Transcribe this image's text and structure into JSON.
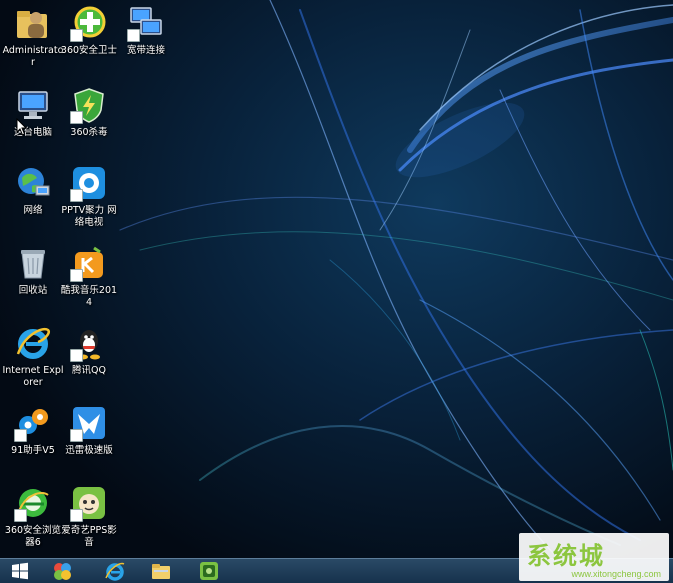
{
  "desktop": {
    "icons": [
      {
        "label": "Administrator",
        "icon": "user-folder-icon"
      },
      {
        "label": "360安全卫士",
        "icon": "360-safeguard-icon"
      },
      {
        "label": "宽带连接",
        "icon": "broadband-connection-icon"
      },
      {
        "label": "这台电脑",
        "icon": "this-pc-icon"
      },
      {
        "label": "360杀毒",
        "icon": "360-antivirus-icon"
      },
      {
        "label": "网络",
        "icon": "network-icon"
      },
      {
        "label": "PPTV聚力 网络电视",
        "icon": "pptv-icon"
      },
      {
        "label": "回收站",
        "icon": "recycle-bin-icon"
      },
      {
        "label": "酷我音乐2014",
        "icon": "kuwo-music-icon"
      },
      {
        "label": "Internet Explorer",
        "icon": "internet-explorer-icon"
      },
      {
        "label": "腾讯QQ",
        "icon": "qq-icon"
      },
      {
        "label": "91助手V5",
        "icon": "91-assistant-icon"
      },
      {
        "label": "迅雷极速版",
        "icon": "xunlei-icon"
      },
      {
        "label": "360安全浏览器6",
        "icon": "360-browser-icon"
      },
      {
        "label": "爱奇艺PPS影音",
        "icon": "iqiyi-pps-icon"
      }
    ]
  },
  "taskbar": {
    "items": [
      {
        "name": "start-button",
        "icon": "windows-logo-icon"
      },
      {
        "name": "taskbar-app-1",
        "icon": "color-ball-app-icon"
      },
      {
        "name": "taskbar-internet-explorer",
        "icon": "internet-explorer-icon"
      },
      {
        "name": "taskbar-file-explorer",
        "icon": "folder-icon"
      },
      {
        "name": "taskbar-app-4",
        "icon": "iqiyi-box-icon"
      }
    ]
  },
  "watermark": {
    "title": "系统城",
    "url": "www.xitongcheng.com"
  },
  "colors": {
    "taskbar": "#1e3d5a",
    "wallpaper_base": "#05101c",
    "wallpaper_streak": "#3a8cff",
    "watermark_green": "#8cc63f"
  }
}
